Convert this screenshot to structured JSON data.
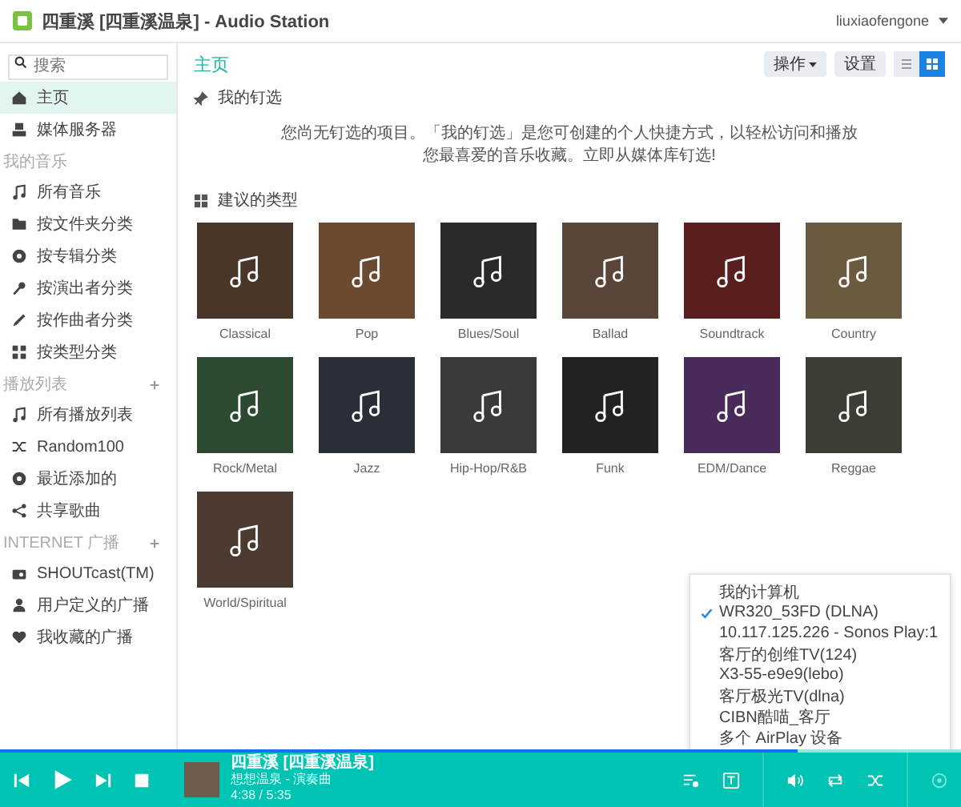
{
  "window": {
    "title": "四重溪 [四重溪温泉] - Audio Station",
    "user": "liuxiaofengone"
  },
  "search": {
    "placeholder": "搜索"
  },
  "sidebar": {
    "sections": [
      {
        "items": [
          {
            "label": "主页",
            "selected": true
          },
          {
            "label": "媒体服务器",
            "selected": false
          }
        ]
      },
      {
        "heading": "我的音乐",
        "items": [
          {
            "label": "所有音乐",
            "selected": false
          },
          {
            "label": "按文件夹分类",
            "selected": false
          },
          {
            "label": "按专辑分类",
            "selected": false
          },
          {
            "label": "按演出者分类",
            "selected": false
          },
          {
            "label": "按作曲者分类",
            "selected": false
          },
          {
            "label": "按类型分类",
            "selected": false
          }
        ]
      },
      {
        "heading": "播放列表",
        "add": true,
        "items": [
          {
            "label": "所有播放列表",
            "selected": false
          },
          {
            "label": "Random100",
            "selected": false
          },
          {
            "label": "最近添加的",
            "selected": false
          },
          {
            "label": "共享歌曲",
            "selected": false
          }
        ]
      },
      {
        "heading": "INTERNET 广播",
        "add": true,
        "items": [
          {
            "label": "SHOUTcast(TM)",
            "selected": false
          },
          {
            "label": "用户定义的广播",
            "selected": false
          },
          {
            "label": "我收藏的广播",
            "selected": false
          }
        ]
      }
    ]
  },
  "main": {
    "title": "主页",
    "buttons": [
      {
        "label": "操作",
        "dropdown": true
      },
      {
        "label": "设置",
        "dropdown": false
      }
    ],
    "view_modes": [
      {
        "kind": "list",
        "selected": false
      },
      {
        "kind": "grid",
        "selected": true
      }
    ]
  },
  "pinned": {
    "heading": "我的钉选",
    "message": "您尚无钉选的项目。「我的钉选」是您可创建的个人快捷方式，以轻松访问和播放您最喜爱的音乐收藏。立即从媒体库钉选!"
  },
  "genres": {
    "heading": "建议的类型",
    "items": [
      {
        "label": "Classical"
      },
      {
        "label": "Pop"
      },
      {
        "label": "Blues/Soul"
      },
      {
        "label": "Ballad"
      },
      {
        "label": "Soundtrack"
      },
      {
        "label": "Country"
      },
      {
        "label": "Rock/Metal"
      },
      {
        "label": "Jazz"
      },
      {
        "label": "Hip-Hop/R&B"
      },
      {
        "label": "Funk"
      },
      {
        "label": "EDM/Dance"
      },
      {
        "label": "Reggae"
      },
      {
        "label": "World/Spiritual"
      }
    ]
  },
  "output_menu": {
    "items": [
      {
        "label": "我的计算机",
        "checked": false
      },
      {
        "label": "WR320_53FD (DLNA)",
        "checked": true
      },
      {
        "label": "10.117.125.226 - Sonos Play:1",
        "checked": false
      },
      {
        "label": "客厅的创维TV(124)",
        "checked": false
      },
      {
        "label": "X3-55-e9e9(lebo)",
        "checked": false
      },
      {
        "label": "客厅极光TV(dlna)",
        "checked": false
      },
      {
        "label": "CIBN酷喵_客厅",
        "checked": false
      },
      {
        "label": "多个 AirPlay 设备",
        "checked": false
      }
    ]
  },
  "player": {
    "title": "四重溪 [四重溪温泉]",
    "subtitle": "想想温泉 - 演奏曲",
    "time": "4:38 / 5:35",
    "level": 0.83
  }
}
